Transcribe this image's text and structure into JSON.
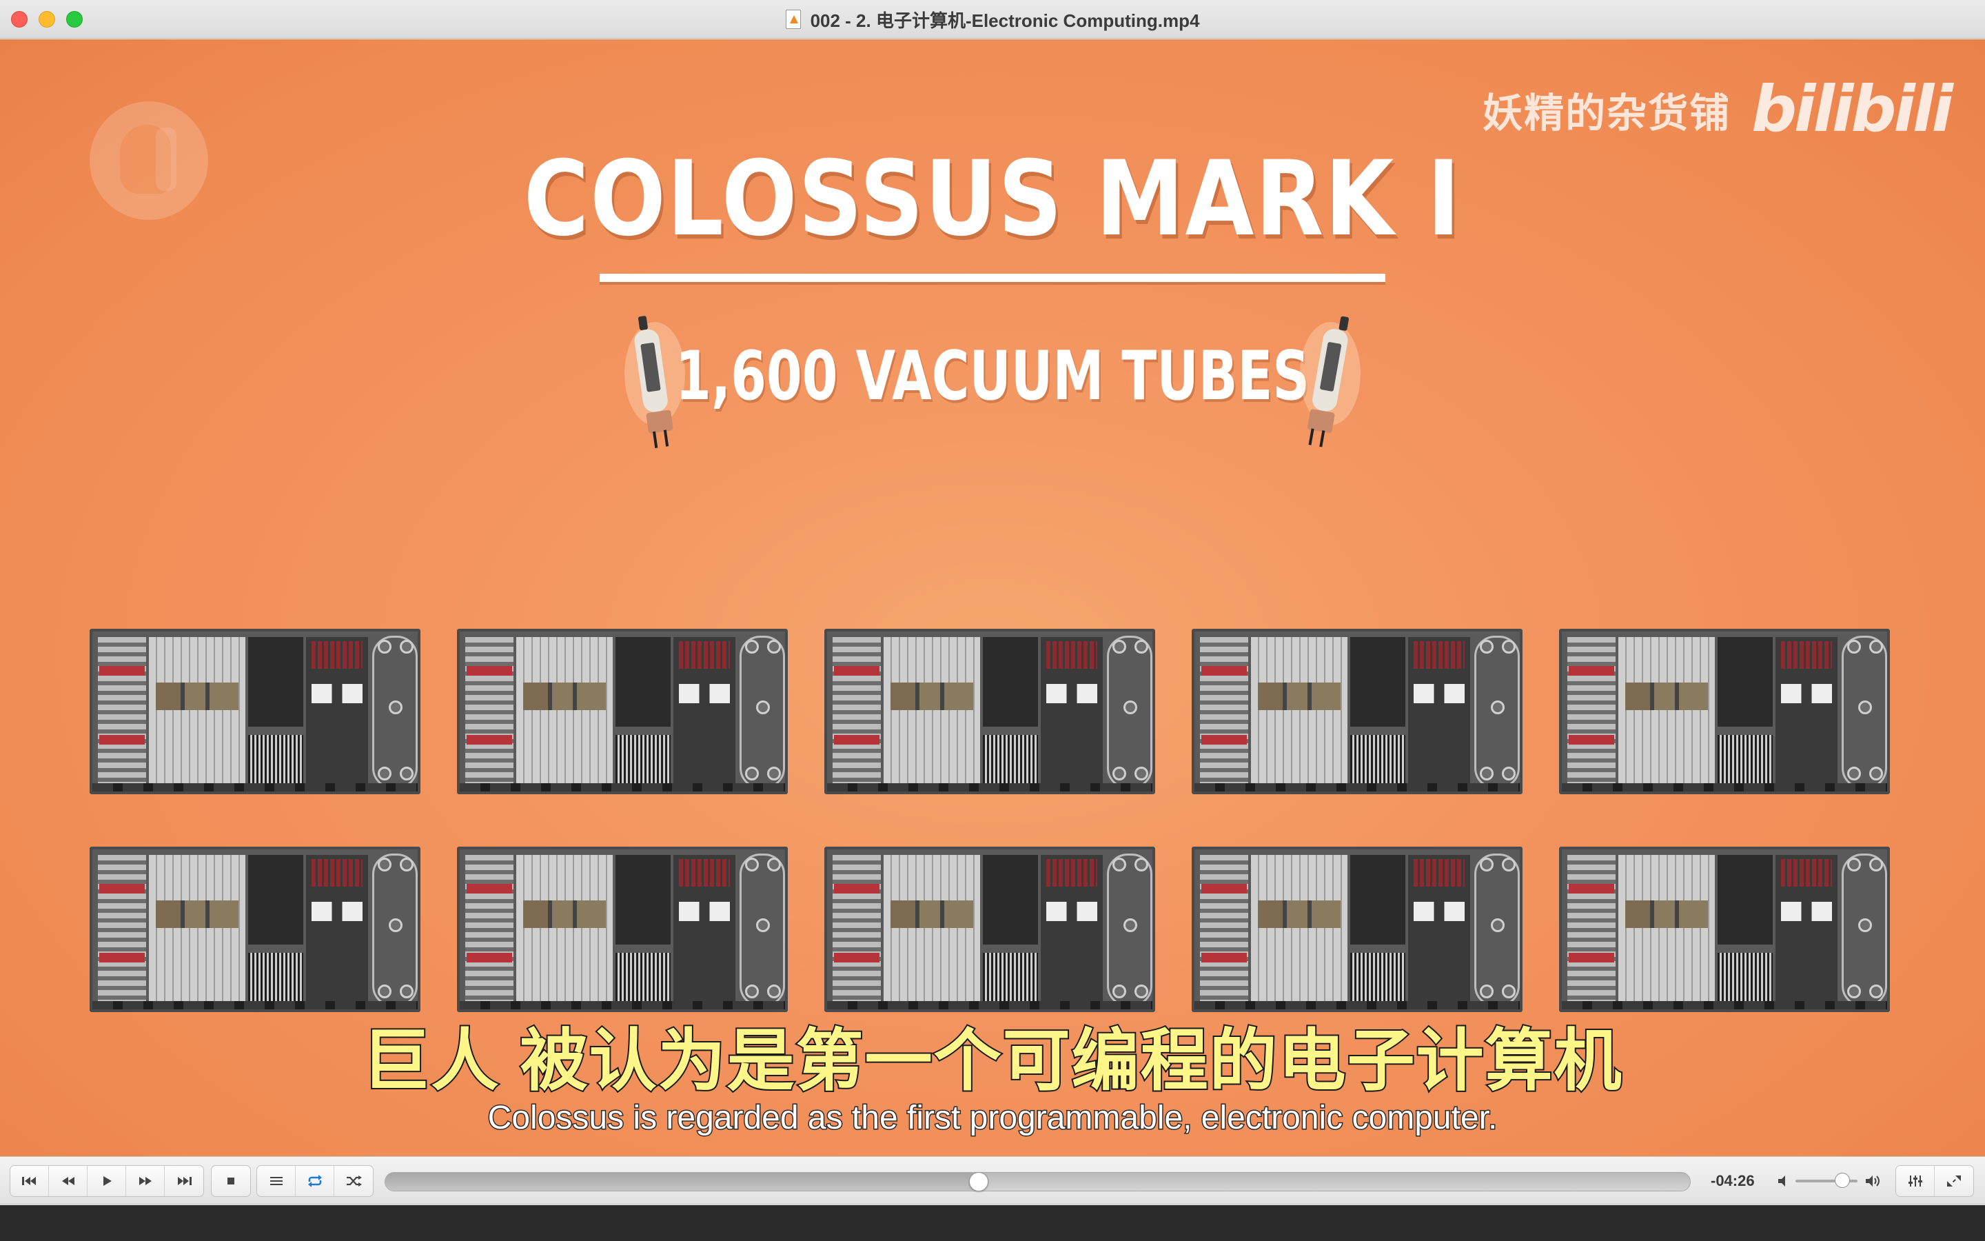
{
  "window": {
    "title": "002 - 2. 电子计算机-Electronic Computing.mp4"
  },
  "video": {
    "heading": "COLOSSUS MARK I",
    "subheading": "1,600 VACUUM TUBES",
    "watermark_text": "妖精的杂货铺",
    "watermark_logo": "bilibili",
    "subtitle_cn": "巨人 被认为是第一个可编程的电子计算机",
    "subtitle_en": "Colossus is regarded as the first programmable, electronic computer.",
    "machines_rows": 2,
    "machines_per_row": 5
  },
  "controls": {
    "buttons_left": [
      {
        "name": "skip-back-button",
        "icon": "skip-to-start-icon"
      },
      {
        "name": "rewind-button",
        "icon": "rewind-icon"
      },
      {
        "name": "play-button",
        "icon": "play-icon"
      },
      {
        "name": "fast-forward-button",
        "icon": "fast-forward-icon"
      },
      {
        "name": "skip-forward-button",
        "icon": "skip-to-end-icon"
      }
    ],
    "stop_icon": "stop-icon",
    "playlist_icon": "playlist-icon",
    "loop_icon": "loop-icon",
    "shuffle_icon": "shuffle-icon",
    "progress": 0.455,
    "time_remaining": "-04:26",
    "volume": 0.75,
    "accent_color": "#1e7ad9"
  }
}
